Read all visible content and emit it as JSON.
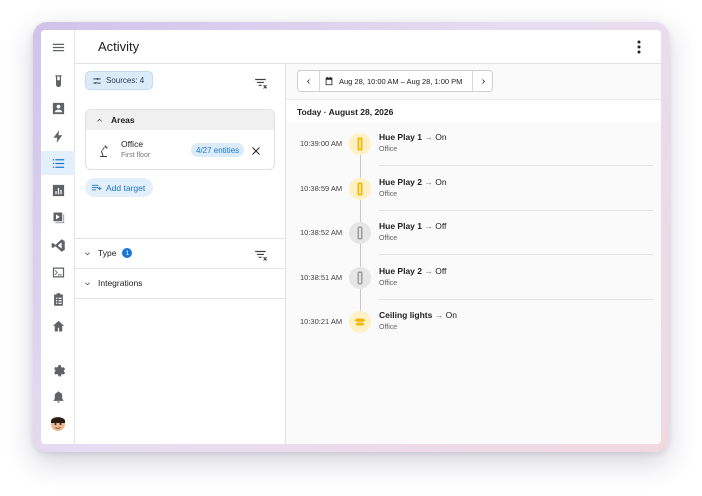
{
  "header": {
    "title": "Activity"
  },
  "sidebar": {
    "items": [
      {
        "icon": "menu-icon"
      },
      {
        "icon": "test-tube-icon"
      },
      {
        "icon": "account-box-icon"
      },
      {
        "icon": "lightning-icon"
      },
      {
        "icon": "logbook-list-icon",
        "active": true
      },
      {
        "icon": "history-chart-icon"
      },
      {
        "icon": "media-icon"
      },
      {
        "icon": "code-icon"
      },
      {
        "icon": "terminal-icon"
      },
      {
        "icon": "clipboard-list-icon"
      },
      {
        "icon": "home-icon"
      },
      {
        "icon": "settings-icon"
      },
      {
        "icon": "bell-icon"
      },
      {
        "icon": "avatar"
      }
    ]
  },
  "filters": {
    "sources_label": "Sources: 4",
    "areas_title": "Areas",
    "area": {
      "name": "Office",
      "floor": "First floor",
      "entities": "4/27 entities"
    },
    "add_target_label": "Add target",
    "type_label": "Type",
    "type_count": "1",
    "integrations_label": "Integrations"
  },
  "date": {
    "range": "Aug 28, 10:00 AM – Aug 28, 1:00 PM"
  },
  "day_header": "Today · August 28, 2026",
  "events": [
    {
      "time": "10:39:00 AM",
      "name": "Hue Play 1",
      "state": "On",
      "area": "Office",
      "icon": "light-bar-icon",
      "status": "on"
    },
    {
      "time": "10:38:59 AM",
      "name": "Hue Play 2",
      "state": "On",
      "area": "Office",
      "icon": "light-bar-icon",
      "status": "on"
    },
    {
      "time": "10:38:52 AM",
      "name": "Hue Play 1",
      "state": "Off",
      "area": "Office",
      "icon": "light-bar-icon",
      "status": "off"
    },
    {
      "time": "10:38:51 AM",
      "name": "Hue Play 2",
      "state": "Off",
      "area": "Office",
      "icon": "light-bar-icon",
      "status": "off"
    },
    {
      "time": "10:30:21 AM",
      "name": "Ceiling lights",
      "state": "On",
      "area": "Office",
      "icon": "ceiling-light-icon",
      "status": "on"
    }
  ],
  "colors": {
    "accent": "#1976d2",
    "on_icon": "#f2b705",
    "off_icon": "#9e9e9e"
  }
}
